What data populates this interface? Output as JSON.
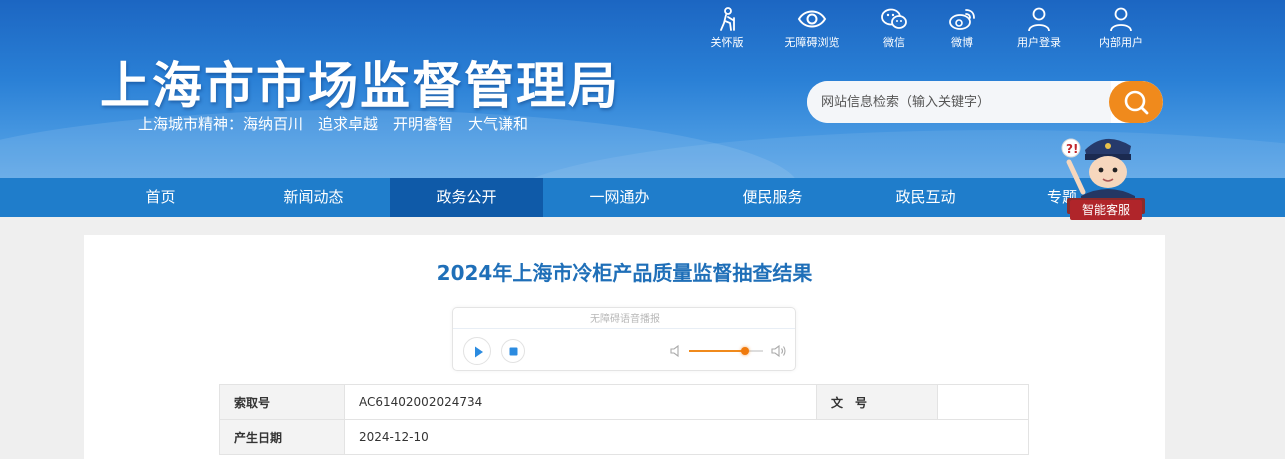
{
  "header": {
    "site_title": "上海市市场监督管理局",
    "slogan": "上海城市精神：海纳百川　追求卓越　开明睿智　大气谦和",
    "top_links": [
      {
        "label": "关怀版",
        "icon": "elder-care-icon"
      },
      {
        "label": "无障碍浏览",
        "icon": "eye-icon"
      },
      {
        "label": "微信",
        "icon": "wechat-icon"
      },
      {
        "label": "微博",
        "icon": "weibo-icon"
      },
      {
        "label": "用户登录",
        "icon": "user-icon"
      },
      {
        "label": "内部用户",
        "icon": "internal-user-icon"
      }
    ],
    "search": {
      "placeholder": "网站信息检索（输入关键字）",
      "button_icon": "search-icon"
    },
    "colors": {
      "header_blue": "#1c66c2",
      "nav_blue": "#1f7dcb",
      "nav_active": "#0f5aa8",
      "accent_orange": "#f08a1c"
    }
  },
  "nav": {
    "items": [
      {
        "label": "首页"
      },
      {
        "label": "新闻动态"
      },
      {
        "label": "政务公开",
        "active": true
      },
      {
        "label": "一网通办"
      },
      {
        "label": "便民服务"
      },
      {
        "label": "政民互动"
      },
      {
        "label": "专题"
      }
    ]
  },
  "service": {
    "label": "智能客服"
  },
  "article": {
    "title": "2024年上海市冷柜产品质量监督抽查结果",
    "player": {
      "label": "无障碍语音播报",
      "volume": 0.75
    },
    "info": {
      "index_label": "索取号",
      "index_value": "AC61402002024734",
      "doc_no_label": "文　号",
      "doc_no_value": "",
      "date_label": "产生日期",
      "date_value": "2024-12-10"
    }
  }
}
